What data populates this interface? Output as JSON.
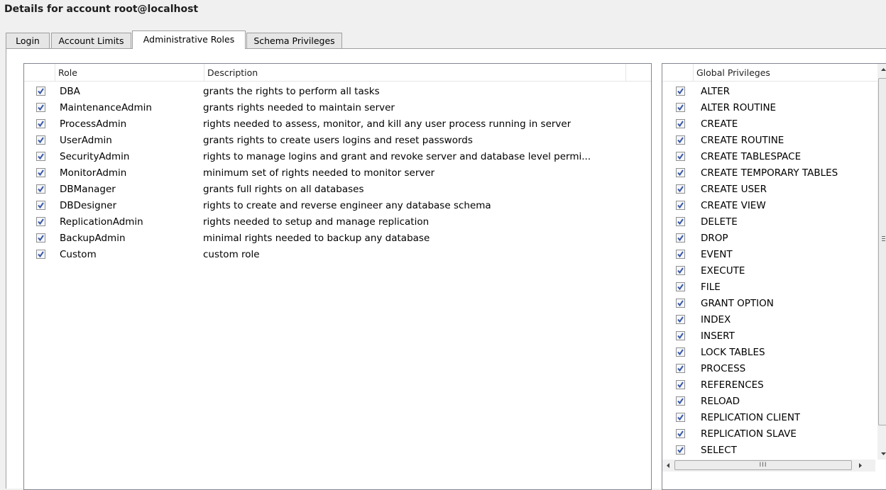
{
  "window": {
    "title": "Details for account root@localhost"
  },
  "tabs": [
    {
      "label": "Login",
      "active": false
    },
    {
      "label": "Account Limits",
      "active": false
    },
    {
      "label": "Administrative Roles",
      "active": true
    },
    {
      "label": "Schema Privileges",
      "active": false
    }
  ],
  "roles_table": {
    "columns": {
      "role": "Role",
      "description": "Description"
    },
    "rows": [
      {
        "checked": true,
        "role": "DBA",
        "description": "grants the rights to perform all tasks"
      },
      {
        "checked": true,
        "role": "MaintenanceAdmin",
        "description": "grants rights needed to maintain server"
      },
      {
        "checked": true,
        "role": "ProcessAdmin",
        "description": "rights needed to assess, monitor, and kill any user process running in server"
      },
      {
        "checked": true,
        "role": "UserAdmin",
        "description": "grants rights to create users logins and reset passwords"
      },
      {
        "checked": true,
        "role": "SecurityAdmin",
        "description": "rights to manage logins and grant and revoke server and database level permi..."
      },
      {
        "checked": true,
        "role": "MonitorAdmin",
        "description": "minimum set of rights needed to monitor server"
      },
      {
        "checked": true,
        "role": "DBManager",
        "description": "grants full rights on all databases"
      },
      {
        "checked": true,
        "role": "DBDesigner",
        "description": "rights to create and reverse engineer any database schema"
      },
      {
        "checked": true,
        "role": "ReplicationAdmin",
        "description": "rights needed to setup and manage replication"
      },
      {
        "checked": true,
        "role": "BackupAdmin",
        "description": "minimal rights needed to backup any database"
      },
      {
        "checked": true,
        "role": "Custom",
        "description": "custom role"
      }
    ]
  },
  "global_privileges": {
    "header": "Global Privileges",
    "items": [
      {
        "checked": true,
        "label": "ALTER"
      },
      {
        "checked": true,
        "label": "ALTER ROUTINE"
      },
      {
        "checked": true,
        "label": "CREATE"
      },
      {
        "checked": true,
        "label": "CREATE ROUTINE"
      },
      {
        "checked": true,
        "label": "CREATE TABLESPACE"
      },
      {
        "checked": true,
        "label": "CREATE TEMPORARY TABLES"
      },
      {
        "checked": true,
        "label": "CREATE USER"
      },
      {
        "checked": true,
        "label": "CREATE VIEW"
      },
      {
        "checked": true,
        "label": "DELETE"
      },
      {
        "checked": true,
        "label": "DROP"
      },
      {
        "checked": true,
        "label": "EVENT"
      },
      {
        "checked": true,
        "label": "EXECUTE"
      },
      {
        "checked": true,
        "label": "FILE"
      },
      {
        "checked": true,
        "label": "GRANT OPTION"
      },
      {
        "checked": true,
        "label": "INDEX"
      },
      {
        "checked": true,
        "label": "INSERT"
      },
      {
        "checked": true,
        "label": "LOCK TABLES"
      },
      {
        "checked": true,
        "label": "PROCESS"
      },
      {
        "checked": true,
        "label": "REFERENCES"
      },
      {
        "checked": true,
        "label": "RELOAD"
      },
      {
        "checked": true,
        "label": "REPLICATION CLIENT"
      },
      {
        "checked": true,
        "label": "REPLICATION SLAVE"
      },
      {
        "checked": true,
        "label": "SELECT"
      }
    ],
    "hscroll_grip": "III"
  },
  "colors": {
    "checkmark": "#3a58a8",
    "checkbox_border": "#8f8f8f",
    "panel_border": "#828790"
  }
}
